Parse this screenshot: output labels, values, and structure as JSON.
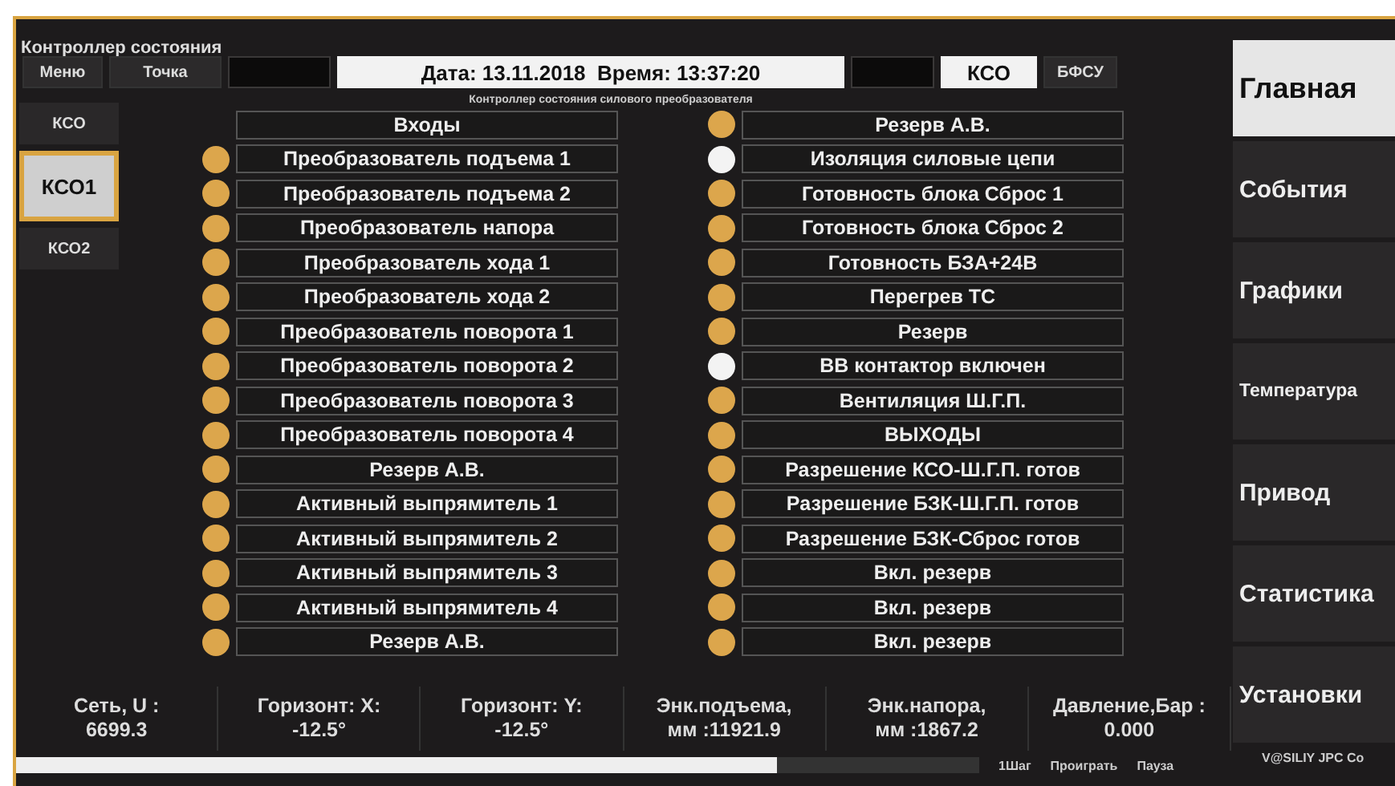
{
  "window": {
    "title": "Контроллер состояния"
  },
  "toolbar": {
    "buttons": [
      "Меню",
      "Точка"
    ],
    "datetime": "Дата: 13.11.2018  Время: 13:37:20",
    "mode": "КСО",
    "mode_button": "БФСУ"
  },
  "subtitle": "Контроллер состояния силового преобразователя",
  "sidebar": {
    "items": [
      {
        "label": "КСО",
        "selected": false
      },
      {
        "label": "КСО1",
        "selected": true
      },
      {
        "label": "КСО2",
        "selected": false
      }
    ]
  },
  "inputs": {
    "header": "Входы",
    "items": [
      {
        "label": "Преобразователь подъема 1",
        "active": true
      },
      {
        "label": "Преобразователь подъема 2",
        "active": true
      },
      {
        "label": "Преобразователь напора",
        "active": true
      },
      {
        "label": "Преобразователь хода 1",
        "active": true
      },
      {
        "label": "Преобразователь хода 2",
        "active": true
      },
      {
        "label": "Преобразователь поворота 1",
        "active": true
      },
      {
        "label": "Преобразователь поворота 2",
        "active": true
      },
      {
        "label": "Преобразователь поворота 3",
        "active": true
      },
      {
        "label": "Преобразователь поворота 4",
        "active": true
      },
      {
        "label": "Резерв А.В.",
        "active": true
      },
      {
        "label": "Активный выпрямитель 1",
        "active": true
      },
      {
        "label": "Активный выпрямитель 2",
        "active": true
      },
      {
        "label": "Активный выпрямитель 3",
        "active": true
      },
      {
        "label": "Активный выпрямитель 4",
        "active": true
      },
      {
        "label": "Резерв А.В.",
        "active": true
      }
    ]
  },
  "outputs": {
    "items": [
      {
        "label": "Резерв А.В.",
        "active": true
      },
      {
        "label": "Изоляция силовые цепи",
        "active": false
      },
      {
        "label": "Готовность блока Сброс 1",
        "active": true
      },
      {
        "label": "Готовность блока Сброс 2",
        "active": true
      },
      {
        "label": "Готовность БЗА+24В",
        "active": true
      },
      {
        "label": "Перегрев ТС",
        "active": true
      },
      {
        "label": "Резерв",
        "active": true
      },
      {
        "label": "ВВ контактор включен",
        "active": false
      },
      {
        "label": "Вентиляция Ш.Г.П.",
        "active": true
      },
      {
        "label": "ВЫХОДЫ",
        "active": true
      },
      {
        "label": "Разрешение КСО-Ш.Г.П. готов",
        "active": true
      },
      {
        "label": "Разрешение БЗК-Ш.Г.П. готов",
        "active": true
      },
      {
        "label": "Разрешение БЗК-Сброс готов",
        "active": true
      },
      {
        "label": "Вкл. резерв",
        "active": true
      },
      {
        "label": "Вкл. резерв",
        "active": true
      },
      {
        "label": "Вкл. резерв",
        "active": true
      }
    ]
  },
  "readouts": [
    {
      "label": "Сеть, U  :",
      "value": "6699.3"
    },
    {
      "label": "Горизонт: X:",
      "value": "-12.5°"
    },
    {
      "label": "Горизонт: Y:",
      "value": "-12.5°"
    },
    {
      "label": "Энк.подъема,",
      "value": "мм :11921.9"
    },
    {
      "label": "Энк.напора,",
      "value": "мм :1867.2"
    },
    {
      "label": "Давление,Бар :",
      "value": "0.000"
    }
  ],
  "playback": {
    "level": 0.79,
    "controls": [
      "1Шаг",
      "Проиграть",
      "Пауза"
    ]
  },
  "nav": {
    "items": [
      {
        "label": "Главная",
        "selected": true
      },
      {
        "label": "События",
        "selected": false
      },
      {
        "label": "Графики",
        "selected": false
      },
      {
        "label": "Температура",
        "selected": false
      },
      {
        "label": "Привод",
        "selected": false
      },
      {
        "label": "Статистика",
        "selected": false
      },
      {
        "label": "Установки",
        "selected": false
      }
    ]
  },
  "credit": "V@SILIY JPC Co"
}
